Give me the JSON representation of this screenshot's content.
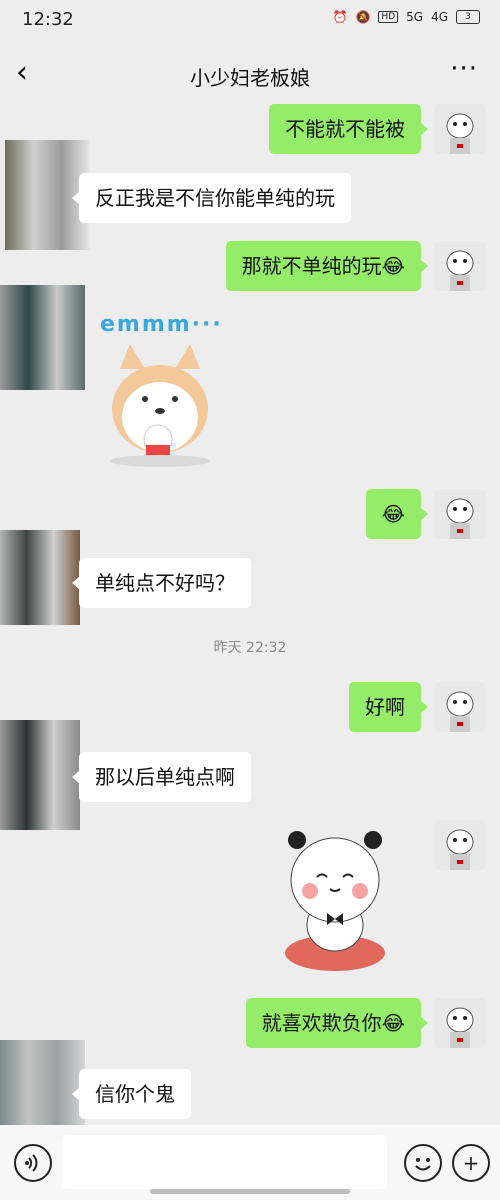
{
  "status": {
    "time": "12:32",
    "signal1": "5G",
    "signal2": "4G",
    "battery": "3"
  },
  "header": {
    "back": "‹",
    "title": "小少妇老板娘",
    "more": "···"
  },
  "messages": [
    {
      "text": "不能就不能被"
    },
    {
      "text": "反正我是不信你能单纯的玩"
    },
    {
      "text": "那就不单纯的玩",
      "emoji": "😂"
    },
    {
      "sticker_text": "emmm···"
    },
    {
      "emoji": "😂"
    },
    {
      "text": "单纯点不好吗？"
    },
    {
      "text": "好啊"
    },
    {
      "text": "那以后单纯点啊"
    },
    {
      "text": "就喜欢欺负你",
      "emoji": "😂"
    },
    {
      "text": "信你个鬼"
    }
  ],
  "timestamp": "昨天 22:32",
  "inputbar": {
    "voice_icon": "voice-icon",
    "emoji_icon": "emoji-icon",
    "plus_icon": "plus-icon"
  }
}
